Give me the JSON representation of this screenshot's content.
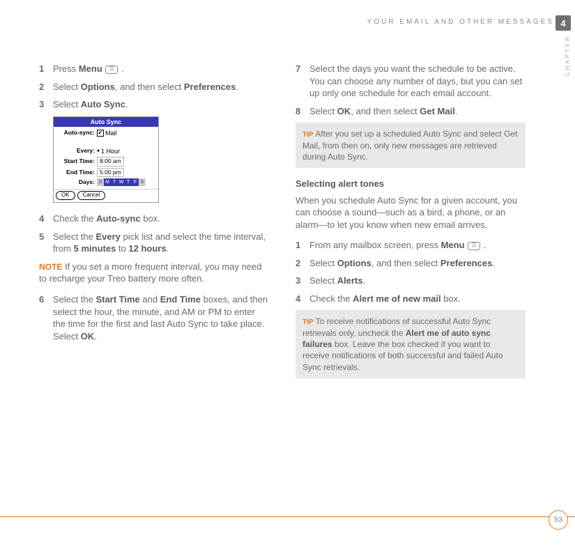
{
  "header": {
    "title": "YOUR EMAIL AND OTHER MESSAGES",
    "chapter_num": "4",
    "chapter_label": "CHAPTER"
  },
  "left": {
    "s1": {
      "num": "1",
      "a": "Press ",
      "b": "Menu",
      "c": " ."
    },
    "s2": {
      "num": "2",
      "a": "Select ",
      "b": "Options",
      "c": ", and then select ",
      "d": "Preferences",
      "e": "."
    },
    "s3": {
      "num": "3",
      "a": "Select ",
      "b": "Auto Sync",
      "c": "."
    },
    "scr": {
      "title": "Auto Sync",
      "autosync_label": "Auto-sync:",
      "autosync_val": "Mail",
      "every_label": "Every:",
      "every_val": "1 Hour",
      "start_label": "Start Time:",
      "start_val": "8:00 am",
      "end_label": "End Time:",
      "end_val": "5:00 pm",
      "days_label": "Days:",
      "days": [
        "S",
        "M",
        "T",
        "W",
        "T",
        "F",
        "S"
      ],
      "ok": "OK",
      "cancel": "Cancel"
    },
    "s4": {
      "num": "4",
      "a": "Check the ",
      "b": "Auto-sync",
      "c": " box."
    },
    "s5": {
      "num": "5",
      "a": "Select the ",
      "b": "Every",
      "c": " pick list and select the time interval, from ",
      "d": "5 minutes",
      "e": " to ",
      "f": "12 hours",
      "g": "."
    },
    "note": {
      "label": "NOTE",
      "text": "  If you set a more frequent interval, you may need to recharge your Treo battery more often."
    },
    "s6": {
      "num": "6",
      "a": "Select the ",
      "b": "Start Time",
      "c": " and ",
      "d": "End Time",
      "e": " boxes, and then select the hour, the minute, and AM or PM to enter the time for the first and last Auto Sync to take place. Select ",
      "f": "OK",
      "g": "."
    }
  },
  "right": {
    "s7": {
      "num": "7",
      "text": "Select the days you want the schedule to be active. You can choose any number of days, but you can set up only one schedule for each email account."
    },
    "s8": {
      "num": "8",
      "a": "Select ",
      "b": "OK",
      "c": ", and then select ",
      "d": "Get Mail",
      "e": "."
    },
    "tip1": {
      "label": "TIP",
      "text": " After you set up a scheduled Auto Sync and select Get Mail, from then on, only new messages are retrieved during Auto Sync."
    },
    "section": {
      "heading": "Selecting alert tones",
      "para": "When you schedule Auto Sync for a given account, you can choose a sound—such as a bird, a phone, or an alarm—to let you know when new email arrives."
    },
    "r1": {
      "num": "1",
      "a": "From any mailbox screen, press ",
      "b": "Menu",
      "c": " ."
    },
    "r2": {
      "num": "2",
      "a": "Select ",
      "b": "Options",
      "c": ", and then select ",
      "d": "Preferences",
      "e": "."
    },
    "r3": {
      "num": "3",
      "a": "Select ",
      "b": "Alerts",
      "c": "."
    },
    "r4": {
      "num": "4",
      "a": "Check the ",
      "b": "Alert me of new mail",
      "c": " box."
    },
    "tip2": {
      "label": "TIP",
      "a": " To receive notifications of successful Auto Sync retrievals only, uncheck the ",
      "b": "Alert me of auto sync failures",
      "c": " box. Leave the box checked if you want to receive notifications of both successful and failed Auto Sync retrievals."
    }
  },
  "footer": {
    "page": "93"
  }
}
